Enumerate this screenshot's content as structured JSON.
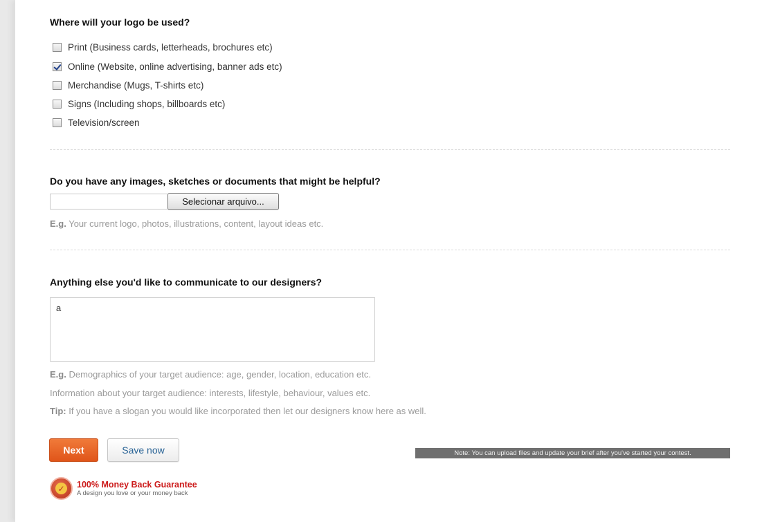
{
  "usage": {
    "heading": "Where will your logo be used?",
    "options": [
      {
        "label": "Print (Business cards, letterheads, brochures etc)",
        "checked": false
      },
      {
        "label": "Online (Website, online advertising, banner ads etc)",
        "checked": true
      },
      {
        "label": "Merchandise (Mugs, T-shirts etc)",
        "checked": false
      },
      {
        "label": "Signs (Including shops, billboards etc)",
        "checked": false
      },
      {
        "label": "Television/screen",
        "checked": false
      }
    ]
  },
  "files": {
    "heading": "Do you have any images, sketches or documents that might be helpful?",
    "button_label": "Selecionar arquivo...",
    "hint_prefix": "E.g.",
    "hint_text": " Your current logo, photos, illustrations, content, layout ideas etc."
  },
  "notes": {
    "heading": "Anything else you'd like to communicate to our designers?",
    "value": "a",
    "hint1_prefix": "E.g.",
    "hint1_text": " Demographics of your target audience: age, gender, location, education etc.",
    "hint2_text": "Information about your target audience: interests, lifestyle, behaviour, values etc.",
    "tip_prefix": "Tip:",
    "tip_text": " If you have a slogan you would like incorporated then let our designers know here as well."
  },
  "actions": {
    "next_label": "Next",
    "save_label": "Save now",
    "note_text": "Note: You can upload files and update your brief after you've started your contest."
  },
  "guarantee": {
    "title": "100% Money Back Guarantee",
    "subtitle": "A design you love or your money back",
    "icon": "checkmark-badge-icon"
  },
  "colors": {
    "accent": "#e9622a",
    "guarantee_red": "#cc1a1a",
    "link_blue": "#2a6496"
  }
}
